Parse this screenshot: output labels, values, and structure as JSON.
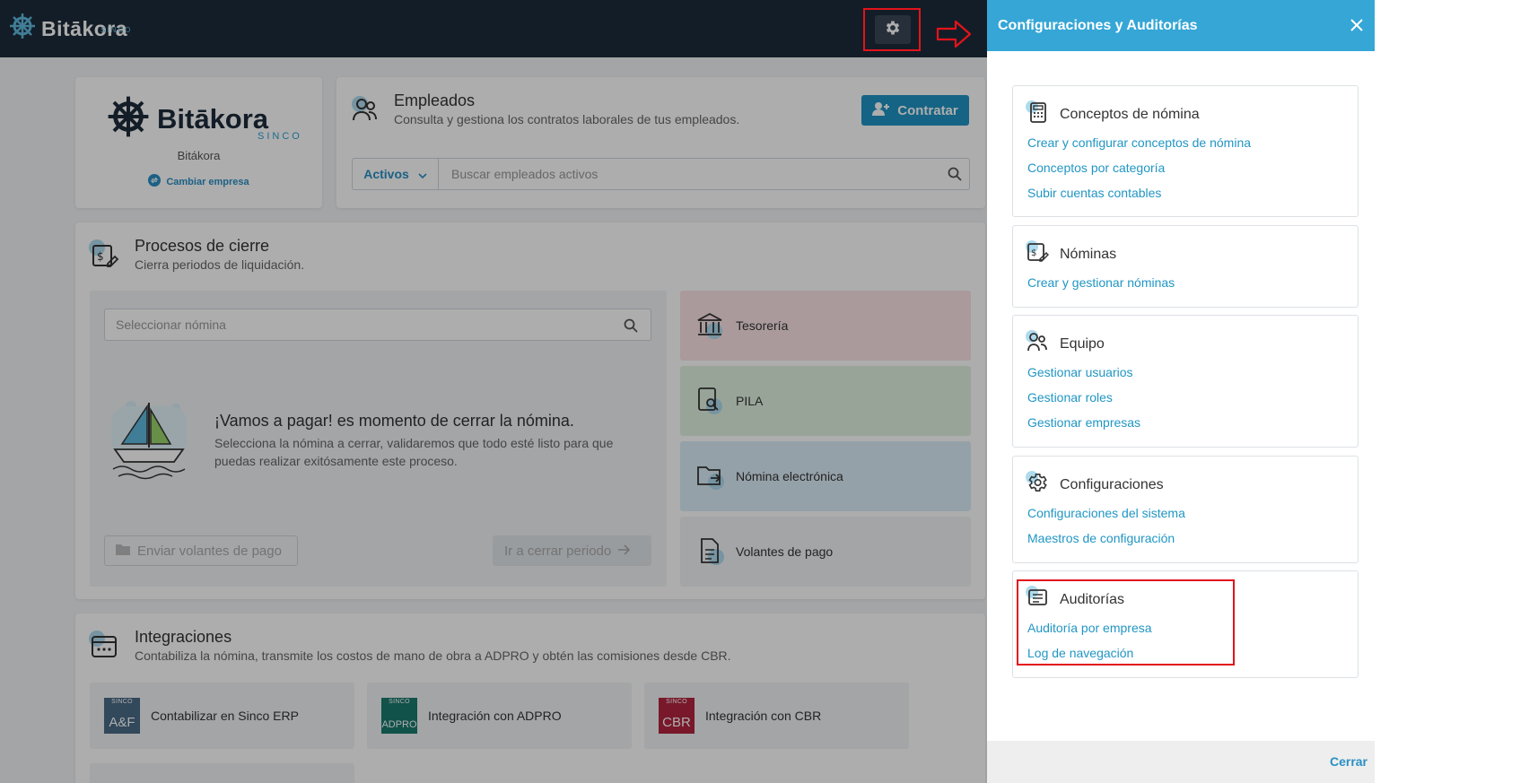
{
  "topbar": {
    "brand": "Bitākora",
    "brand_sub": "SINCO"
  },
  "company": {
    "logo_name": "Bitākora",
    "logo_sub": "SINCO",
    "label": "Bitákora",
    "change_link": "Cambiar empresa"
  },
  "employees": {
    "title": "Empleados",
    "subtitle": "Consulta y gestiona los contratos laborales de tus empleados.",
    "hire_button": "Contratar",
    "filter": "Activos",
    "search_placeholder": "Buscar empleados activos"
  },
  "closing": {
    "title": "Procesos de cierre",
    "subtitle": "Cierra periodos de liquidación.",
    "payroll_placeholder": "Seleccionar nómina",
    "empty_title": "¡Vamos a pagar! es momento de cerrar la nómina.",
    "empty_desc": "Selecciona la nómina a cerrar, validaremos que todo esté listo para que puedas realizar exitósamente este proceso.",
    "send_button": "Enviar volantes de pago",
    "go_button": "Ir a cerrar periodo",
    "tiles": [
      "Tesorería",
      "PILA",
      "Nómina electrónica",
      "Volantes de pago"
    ]
  },
  "integrations": {
    "title": "Integraciones",
    "subtitle": "Contabiliza la nómina, transmite los costos de mano de obra a ADPRO y obtén las comisiones desde CBR.",
    "tiles": [
      {
        "badge_top": "SINCO",
        "badge": "A&F",
        "label": "Contabilizar en Sinco ERP",
        "color": "#4a6a86"
      },
      {
        "badge_top": "SINCO",
        "badge": "ADPRO",
        "label": "Integración con ADPRO",
        "color": "#1a7a6e"
      },
      {
        "badge_top": "SINCO",
        "badge": "CBR",
        "label": "Integración con CBR",
        "color": "#b2243f"
      }
    ]
  },
  "panel": {
    "title": "Configuraciones y Auditorías",
    "footer_close": "Cerrar",
    "sections": [
      {
        "title": "Conceptos de nómina",
        "links": [
          "Crear y configurar conceptos de nómina",
          "Conceptos por categoría",
          "Subir cuentas contables"
        ]
      },
      {
        "title": "Nóminas",
        "links": [
          "Crear y gestionar nóminas"
        ]
      },
      {
        "title": "Equipo",
        "links": [
          "Gestionar usuarios",
          "Gestionar roles",
          "Gestionar empresas"
        ]
      },
      {
        "title": "Configuraciones",
        "links": [
          "Configuraciones del sistema",
          "Maestros de configuración"
        ]
      },
      {
        "title": "Auditorías",
        "links": [
          "Auditoría por empresa",
          "Log de navegación"
        ]
      }
    ]
  },
  "colors": {
    "accent": "#35a6d6",
    "link": "#2196c4",
    "annotation": "#e3131b",
    "topbar": "#1d2b3a"
  }
}
